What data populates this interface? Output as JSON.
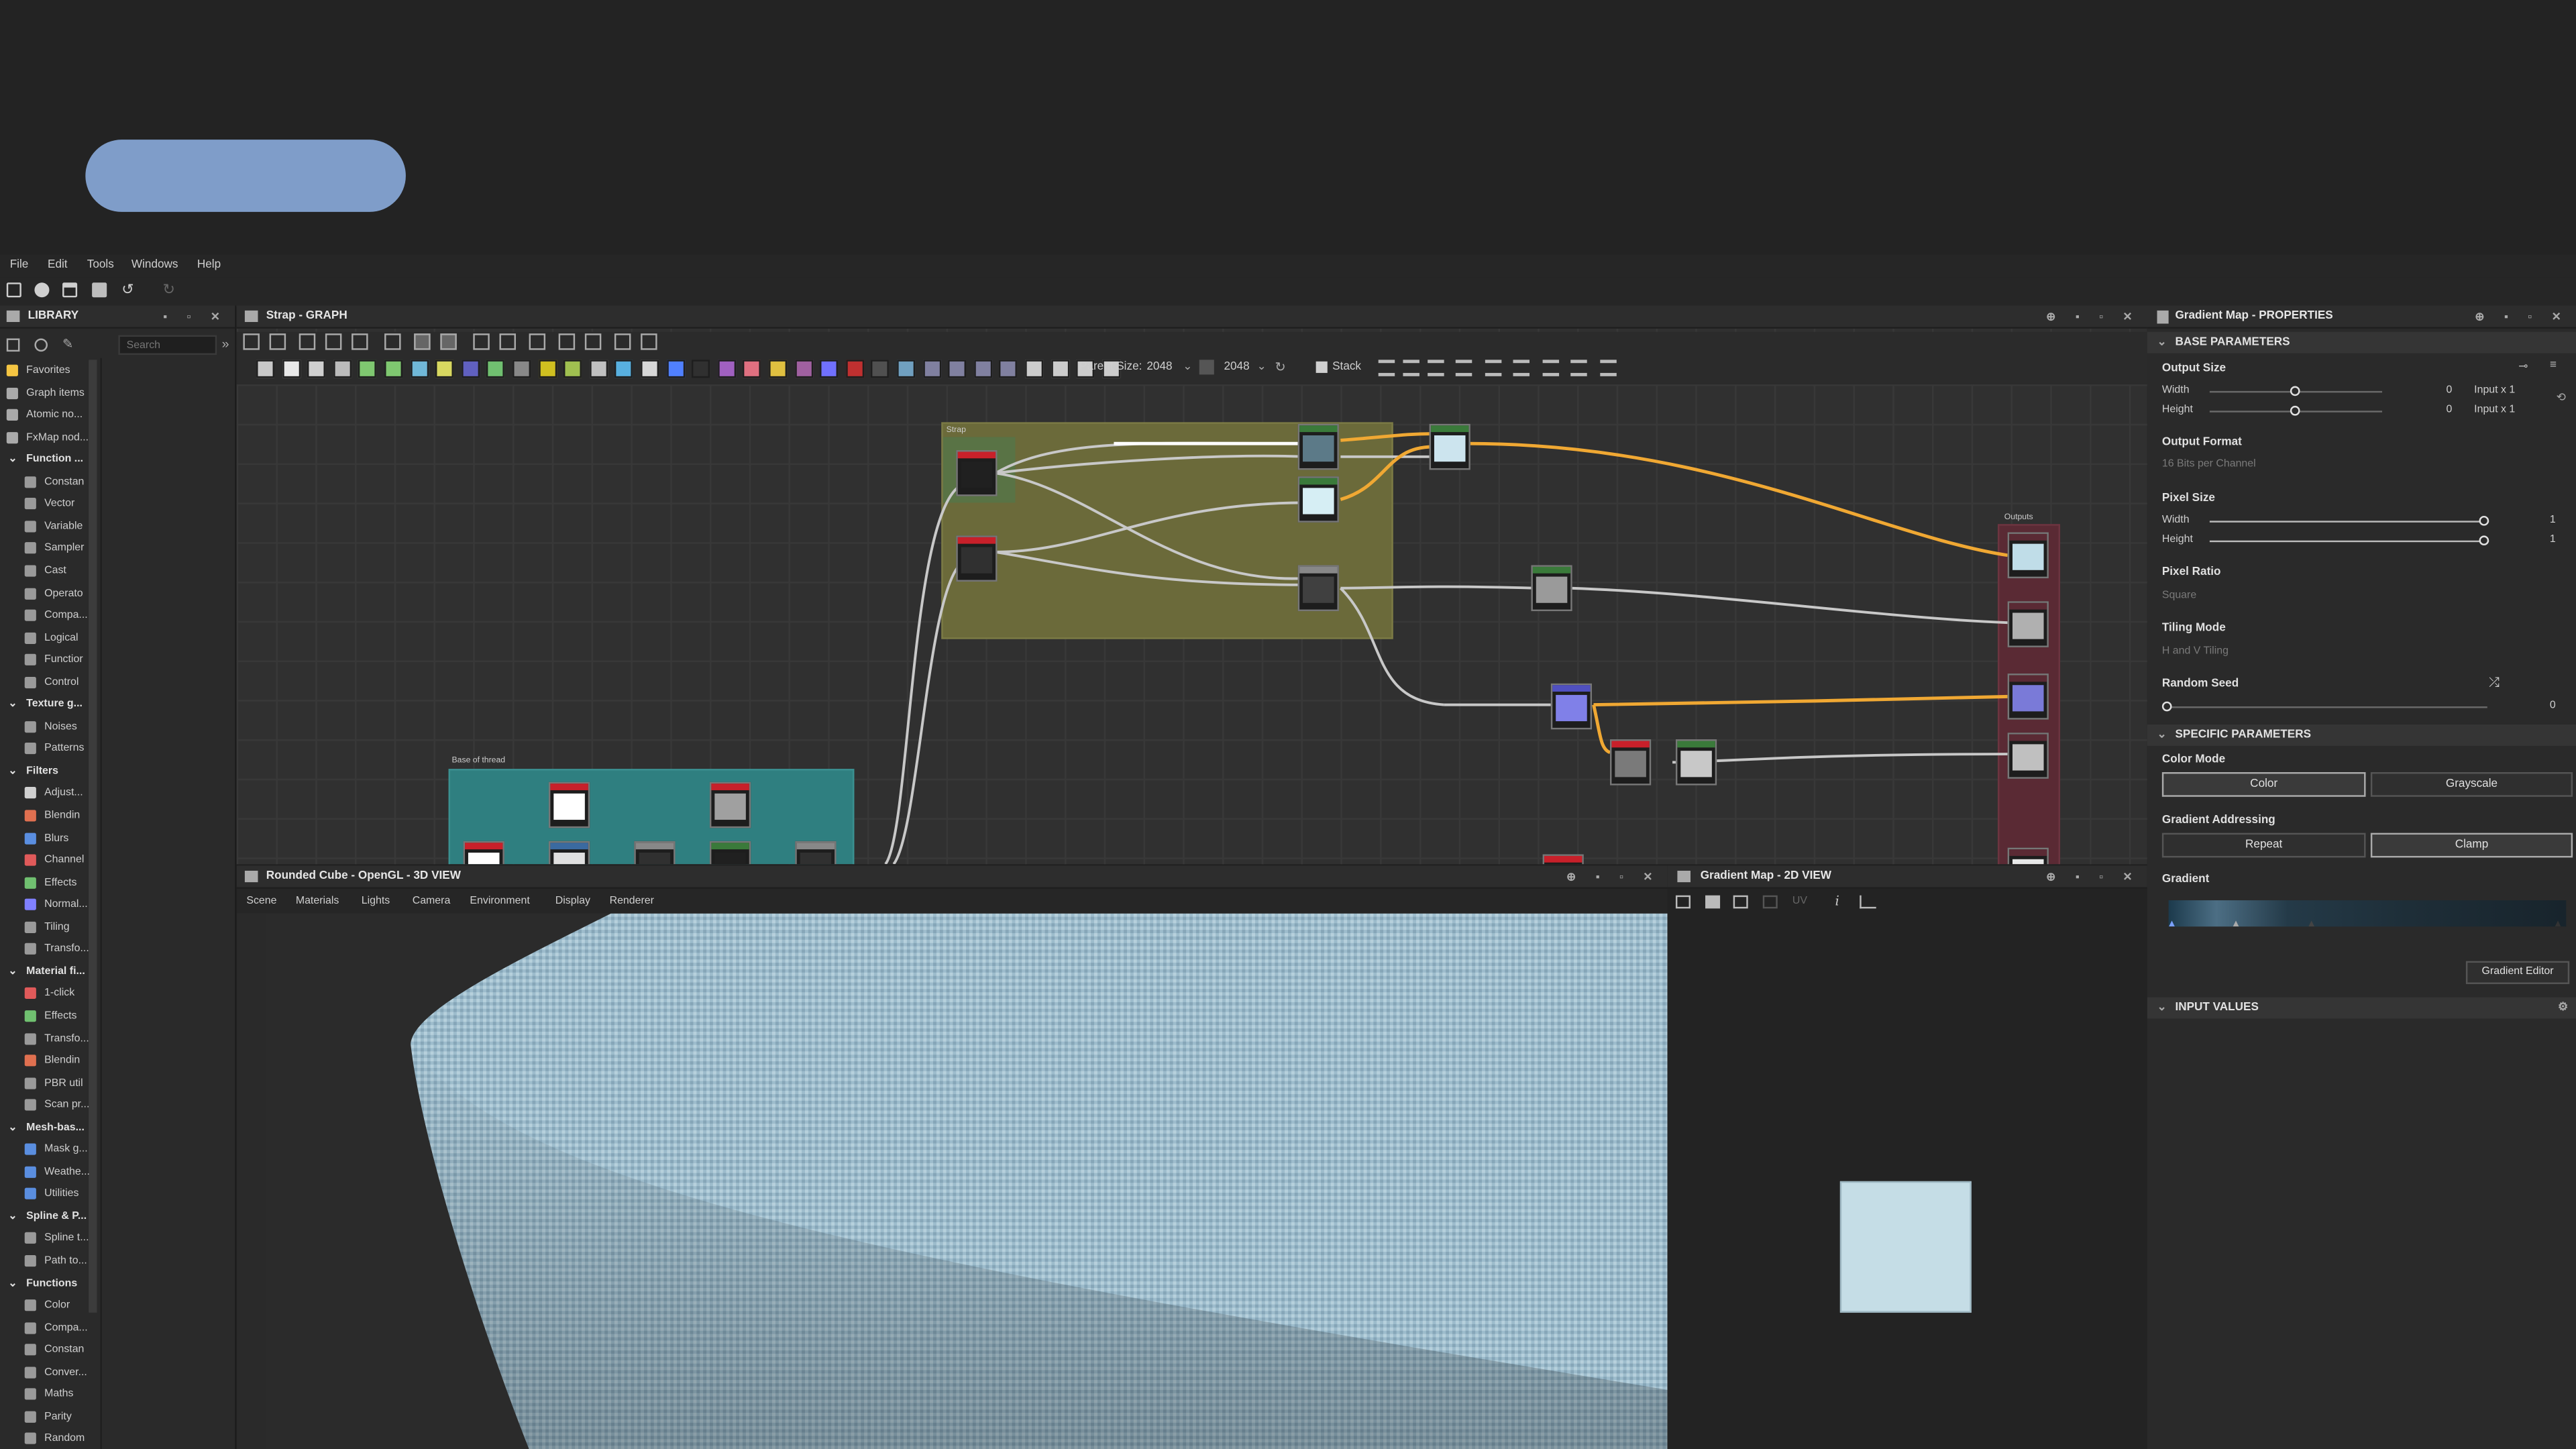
{
  "menu": [
    "File",
    "Edit",
    "Tools",
    "Windows",
    "Help"
  ],
  "library": {
    "title": "LIBRARY",
    "search_placeholder": "Search",
    "items": [
      {
        "label": "Favorites",
        "cat": false,
        "color": "#f5c542"
      },
      {
        "label": "Graph items",
        "cat": false,
        "color": "#aaaaaa"
      },
      {
        "label": "Atomic no...",
        "cat": false,
        "color": "#aaaaaa"
      },
      {
        "label": "FxMap nod...",
        "cat": false,
        "color": "#aaaaaa"
      },
      {
        "label": "Function ...",
        "cat": true
      },
      {
        "label": "Constan",
        "cat": false,
        "color": "#9a9a9a"
      },
      {
        "label": "Vector",
        "cat": false,
        "color": "#9a9a9a"
      },
      {
        "label": "Variable",
        "cat": false,
        "color": "#9a9a9a"
      },
      {
        "label": "Sampler",
        "cat": false,
        "color": "#9a9a9a"
      },
      {
        "label": "Cast",
        "cat": false,
        "color": "#9a9a9a"
      },
      {
        "label": "Operato",
        "cat": false,
        "color": "#9a9a9a"
      },
      {
        "label": "Compa...",
        "cat": false,
        "color": "#9a9a9a"
      },
      {
        "label": "Logical",
        "cat": false,
        "color": "#9a9a9a"
      },
      {
        "label": "Functior",
        "cat": false,
        "color": "#9a9a9a"
      },
      {
        "label": "Control",
        "cat": false,
        "color": "#9a9a9a"
      },
      {
        "label": "Texture g...",
        "cat": true
      },
      {
        "label": "Noises",
        "cat": false,
        "color": "#9a9a9a"
      },
      {
        "label": "Patterns",
        "cat": false,
        "color": "#9a9a9a"
      },
      {
        "label": "Filters",
        "cat": true
      },
      {
        "label": "Adjust...",
        "cat": false,
        "color": "#d0d0d0"
      },
      {
        "label": "Blendin",
        "cat": false,
        "color": "#e07050"
      },
      {
        "label": "Blurs",
        "cat": false,
        "color": "#5a8ee0"
      },
      {
        "label": "Channel",
        "cat": false,
        "color": "#e05a5a"
      },
      {
        "label": "Effects",
        "cat": false,
        "color": "#70c070"
      },
      {
        "label": "Normal...",
        "cat": false,
        "color": "#8080ff"
      },
      {
        "label": "Tiling",
        "cat": false,
        "color": "#9a9a9a"
      },
      {
        "label": "Transfo...",
        "cat": false,
        "color": "#9a9a9a"
      },
      {
        "label": "Material fi...",
        "cat": true
      },
      {
        "label": "1-click",
        "cat": false,
        "color": "#e05a5a"
      },
      {
        "label": "Effects",
        "cat": false,
        "color": "#70c070"
      },
      {
        "label": "Transfo...",
        "cat": false,
        "color": "#9a9a9a"
      },
      {
        "label": "Blendin",
        "cat": false,
        "color": "#e07050"
      },
      {
        "label": "PBR util",
        "cat": false,
        "color": "#9a9a9a"
      },
      {
        "label": "Scan pr...",
        "cat": false,
        "color": "#9a9a9a"
      },
      {
        "label": "Mesh-bas...",
        "cat": true
      },
      {
        "label": "Mask g...",
        "cat": false,
        "color": "#5a8ee0"
      },
      {
        "label": "Weathe...",
        "cat": false,
        "color": "#5a8ee0"
      },
      {
        "label": "Utilities",
        "cat": false,
        "color": "#5a8ee0"
      },
      {
        "label": "Spline & P...",
        "cat": true
      },
      {
        "label": "Spline t...",
        "cat": false,
        "color": "#9a9a9a"
      },
      {
        "label": "Path to...",
        "cat": false,
        "color": "#9a9a9a"
      },
      {
        "label": "Functions",
        "cat": true
      },
      {
        "label": "Color",
        "cat": false,
        "color": "#9a9a9a"
      },
      {
        "label": "Compa...",
        "cat": false,
        "color": "#9a9a9a"
      },
      {
        "label": "Constan",
        "cat": false,
        "color": "#9a9a9a"
      },
      {
        "label": "Conver...",
        "cat": false,
        "color": "#9a9a9a"
      },
      {
        "label": "Maths",
        "cat": false,
        "color": "#9a9a9a"
      },
      {
        "label": "Parity",
        "cat": false,
        "color": "#9a9a9a"
      },
      {
        "label": "Random",
        "cat": false,
        "color": "#9a9a9a"
      }
    ]
  },
  "graph": {
    "title": "Strap - GRAPH",
    "parent_size_label": "Parent Size:",
    "parent_size": "2048",
    "size_value": "2048",
    "stack_label": "Stack",
    "frame_strap": "Strap",
    "frame_base": "Base of thread",
    "frame_outputs": "Outputs"
  },
  "view3d": {
    "title": "Rounded Cube - OpenGL - 3D VIEW",
    "menu": [
      "Scene",
      "Materials",
      "Lights",
      "Camera",
      "Environment",
      "Display",
      "Renderer"
    ]
  },
  "view2d": {
    "title": "Gradient Map - 2D VIEW",
    "uv_label": "UV"
  },
  "properties": {
    "title": "Gradient Map - PROPERTIES",
    "base_section": "BASE PARAMETERS",
    "output_size": "Output Size",
    "width": "Width",
    "height": "Height",
    "output_size_width_value": "0",
    "output_size_height_value": "0",
    "output_size_width_input": "Input x 1",
    "output_size_height_input": "Input x 1",
    "output_format": "Output Format",
    "output_format_value": "16 Bits per Channel",
    "pixel_size": "Pixel Size",
    "pixel_size_width_value": "1",
    "pixel_size_height_value": "1",
    "pixel_ratio": "Pixel Ratio",
    "pixel_ratio_value": "Square",
    "tiling_mode": "Tiling Mode",
    "tiling_mode_value": "H and V Tiling",
    "random_seed": "Random Seed",
    "random_seed_value": "0",
    "specific_section": "SPECIFIC PARAMETERS",
    "color_mode": "Color Mode",
    "color_btn": "Color",
    "grayscale_btn": "Grayscale",
    "gradient_addressing": "Gradient Addressing",
    "repeat_btn": "Repeat",
    "clamp_btn": "Clamp",
    "gradient": "Gradient",
    "gradient_editor_btn": "Gradient Editor",
    "input_section": "INPUT VALUES"
  }
}
